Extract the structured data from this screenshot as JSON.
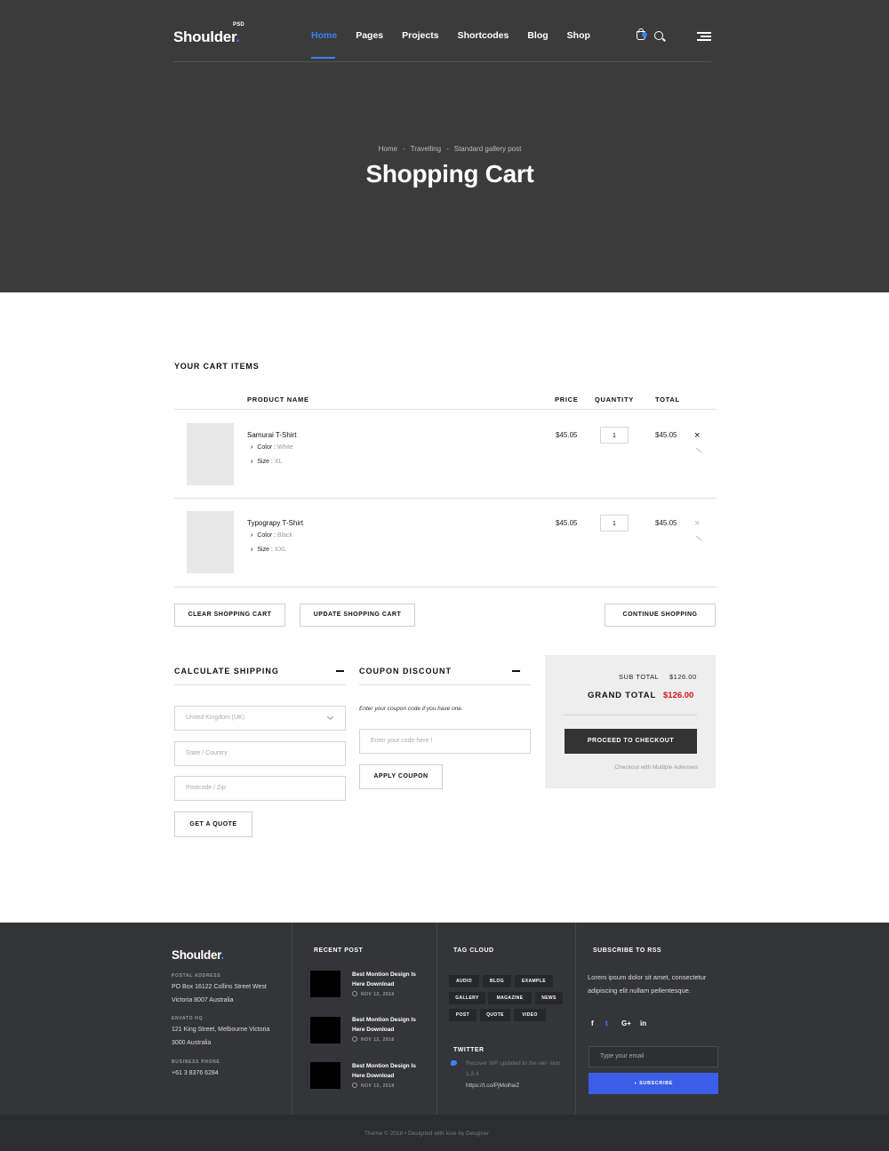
{
  "header": {
    "logo": "Shoulder",
    "logo_dot": ".",
    "logo_badge": "PSD",
    "nav": [
      "Home",
      "Pages",
      "Projects",
      "Shortcodes",
      "Blog",
      "Shop"
    ],
    "active_nav": "Home"
  },
  "hero": {
    "breadcrumb": [
      "Home",
      "Travelling",
      "Standard gallery post"
    ],
    "separator": "-",
    "title": "Shopping Cart"
  },
  "cart": {
    "section_title": "YOUR CART ITEMS",
    "columns": {
      "product": "PRODUCT NAME",
      "price": "PRICE",
      "quantity": "QUANTITY",
      "total": "TOTAL"
    },
    "items": [
      {
        "name": "Samurai T-Shirt",
        "color_label": "Color :",
        "color": "White",
        "size_label": "Size :",
        "size": "XL",
        "price": "$45.05",
        "qty": "1",
        "total": "$45.05",
        "remove": "×"
      },
      {
        "name": "Typograpy T-Shirt",
        "color_label": "Color :",
        "color": "Black",
        "size_label": "Size :",
        "size": "XXL",
        "price": "$45.05",
        "qty": "1",
        "total": "$45.05",
        "remove": "×"
      }
    ],
    "clear_btn": "CLEAR SHOPPING CART",
    "update_btn": "UPDATE SHOPPING CART",
    "continue_btn": "CONTINUE SHOPPING"
  },
  "shipping": {
    "title": "CALCULATE SHIPPING",
    "country": "United Kingdom (UK)",
    "state_placeholder": "State / Country",
    "postcode_placeholder": "Postcode / Zip",
    "quote_btn": "GET A QUOTE"
  },
  "coupon": {
    "title": "COUPON DISCOUNT",
    "note": "Enter your coupon code if you have one.",
    "placeholder": "Enter your code here !",
    "apply_btn": "APPLY COUPON"
  },
  "totals": {
    "subtotal_label": "SUB TOTAL",
    "subtotal": "$126.00",
    "grand_label": "GRAND TOTAL",
    "grand": "$126.00",
    "checkout_btn": "PROCEED TO CHECKOUT",
    "multi_address": "Checkout with Mutilple Adresses",
    "grand_color": "#d41616"
  },
  "footer": {
    "logo": "Shoulder",
    "logo_dot": ".",
    "postal_label": "POSTAL ADDRESS",
    "postal_lines": [
      "PO Box 16122 Collins Street West",
      "Victoria 8007 Australia"
    ],
    "envato_label": "ENVATO HQ",
    "envato_lines": [
      "121 King Street, Melbourne Victoria",
      "3000 Australia"
    ],
    "phone_label": "BUSINESS PHONE",
    "phone": "+61 3 8376 6284",
    "recent_title": "RECENT POST",
    "recent_posts": [
      {
        "title": "Best Montion Design Is Here Download",
        "date": "NOV 12, 2018"
      },
      {
        "title": "Best Montion Design Is Here Download",
        "date": "NOV 12, 2018"
      },
      {
        "title": "Best Montion Design Is Here Download",
        "date": "NOV 12, 2018"
      }
    ],
    "tag_title": "TAG CLOUD",
    "tags": [
      "AUDIO",
      "BLOG",
      "EXAMPLE",
      "GALLERY",
      "MAGAZINE",
      "NEWS",
      "POST",
      "QUOTE",
      "VIDEO"
    ],
    "twitter_title": "TWITTER",
    "tweet": "Recover WP updated to the ver- sion 1.3.4",
    "tweet_link": "https://t.co/PjMoihwZ",
    "rss_title": "SUBSCRIBE TO RSS",
    "rss_text": "Lorem ipsum dolor sit amet, consectetur adipiscing elit nullam pellentesque.",
    "social": [
      "f",
      "t",
      "G+",
      "in"
    ],
    "email_placeholder": "Type your email",
    "subscribe_btn": "SUBSCRIBE",
    "copyright": "Theme © 2018 • Designed with love by Desginer",
    "accent": "#3b5ee8"
  }
}
